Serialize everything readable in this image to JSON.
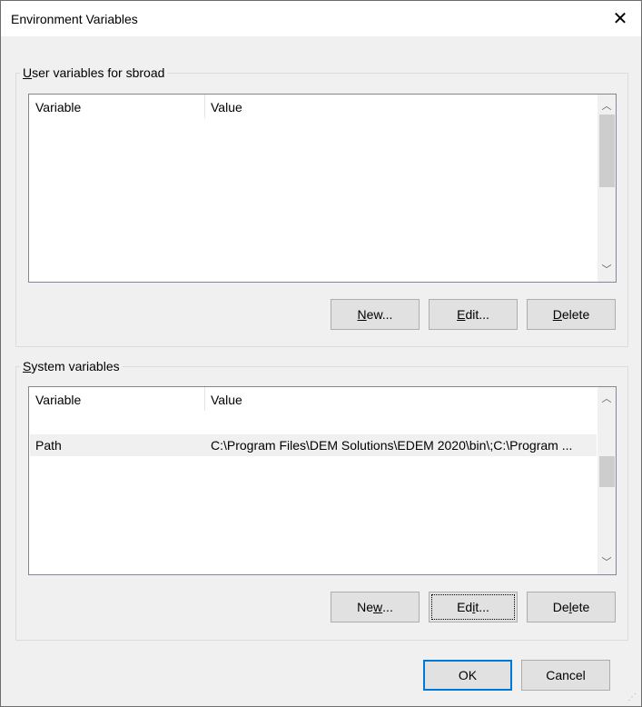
{
  "window": {
    "title": "Environment Variables",
    "close_icon": "close-icon"
  },
  "user": {
    "group_label": {
      "key": "U",
      "rest": "ser variables for sbroad"
    },
    "columns": [
      "Variable",
      "Value"
    ],
    "rows": [],
    "buttons": {
      "new": {
        "pre": "",
        "key": "N",
        "post": "ew..."
      },
      "edit": {
        "pre": "",
        "key": "E",
        "post": "dit..."
      },
      "delete": {
        "pre": "",
        "key": "D",
        "post": "elete"
      }
    }
  },
  "system": {
    "group_label": {
      "key": "S",
      "rest": "ystem variables"
    },
    "columns": [
      "Variable",
      "Value"
    ],
    "rows": [
      {
        "variable": "Path",
        "value": "C:\\Program Files\\DEM Solutions\\EDEM 2020\\bin\\;C:\\Program ..."
      }
    ],
    "buttons": {
      "new": {
        "pre": "Ne",
        "key": "w",
        "post": "..."
      },
      "edit": {
        "pre": "Ed",
        "key": "i",
        "post": "t..."
      },
      "delete": {
        "pre": "De",
        "key": "l",
        "post": "ete"
      }
    }
  },
  "footer": {
    "ok": "OK",
    "cancel": "Cancel"
  }
}
